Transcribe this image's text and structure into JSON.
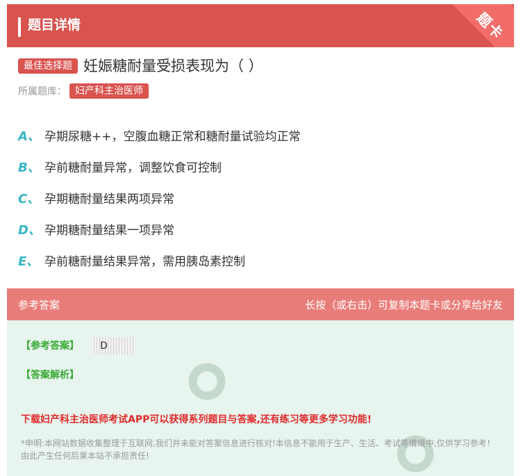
{
  "header": {
    "title": "题目详情",
    "corner_label": "题卡"
  },
  "question": {
    "type_tag": "最佳选择题",
    "text": "妊娠糖耐量受损表现为（ ）",
    "bank_label": "所属题库：",
    "bank_name": "妇产科主治医师"
  },
  "options": [
    {
      "letter": "A、",
      "text": "孕期尿糖++，空腹血糖正常和糖耐量试验均正常"
    },
    {
      "letter": "B、",
      "text": "孕前糖耐量异常，调整饮食可控制"
    },
    {
      "letter": "C、",
      "text": "孕期糖耐量结果两项异常"
    },
    {
      "letter": "D、",
      "text": "孕期糖耐量结果一项异常"
    },
    {
      "letter": "E、",
      "text": "孕前糖耐量结果异常，需用胰岛素控制"
    }
  ],
  "answer": {
    "section_title": "参考答案",
    "hint": "长按（或右击）可复制本题卡或分享给好友",
    "answer_label": "【参考答案】",
    "answer_value": "D",
    "analysis_label": "【答案解析】",
    "promo": "下载妇产科主治医师考试APP可以获得系列题目与答案,还有练习等更多学习功能!",
    "disclaimer": "*申明:本网站数据收集整理于互联网,我们并未能对答案信息进行核对!本信息不能用于生产、生活、考试等情境中,仅供学习参考！由此产生任何后果本站不承担责任!"
  },
  "colors": {
    "primary": "#d9534f",
    "answer_head": "#e87c79",
    "answer_bg": "#e8f5ef",
    "option_letter": "#38b6c6",
    "green_label": "#3aaa35",
    "promo_red": "#e02a2a"
  }
}
